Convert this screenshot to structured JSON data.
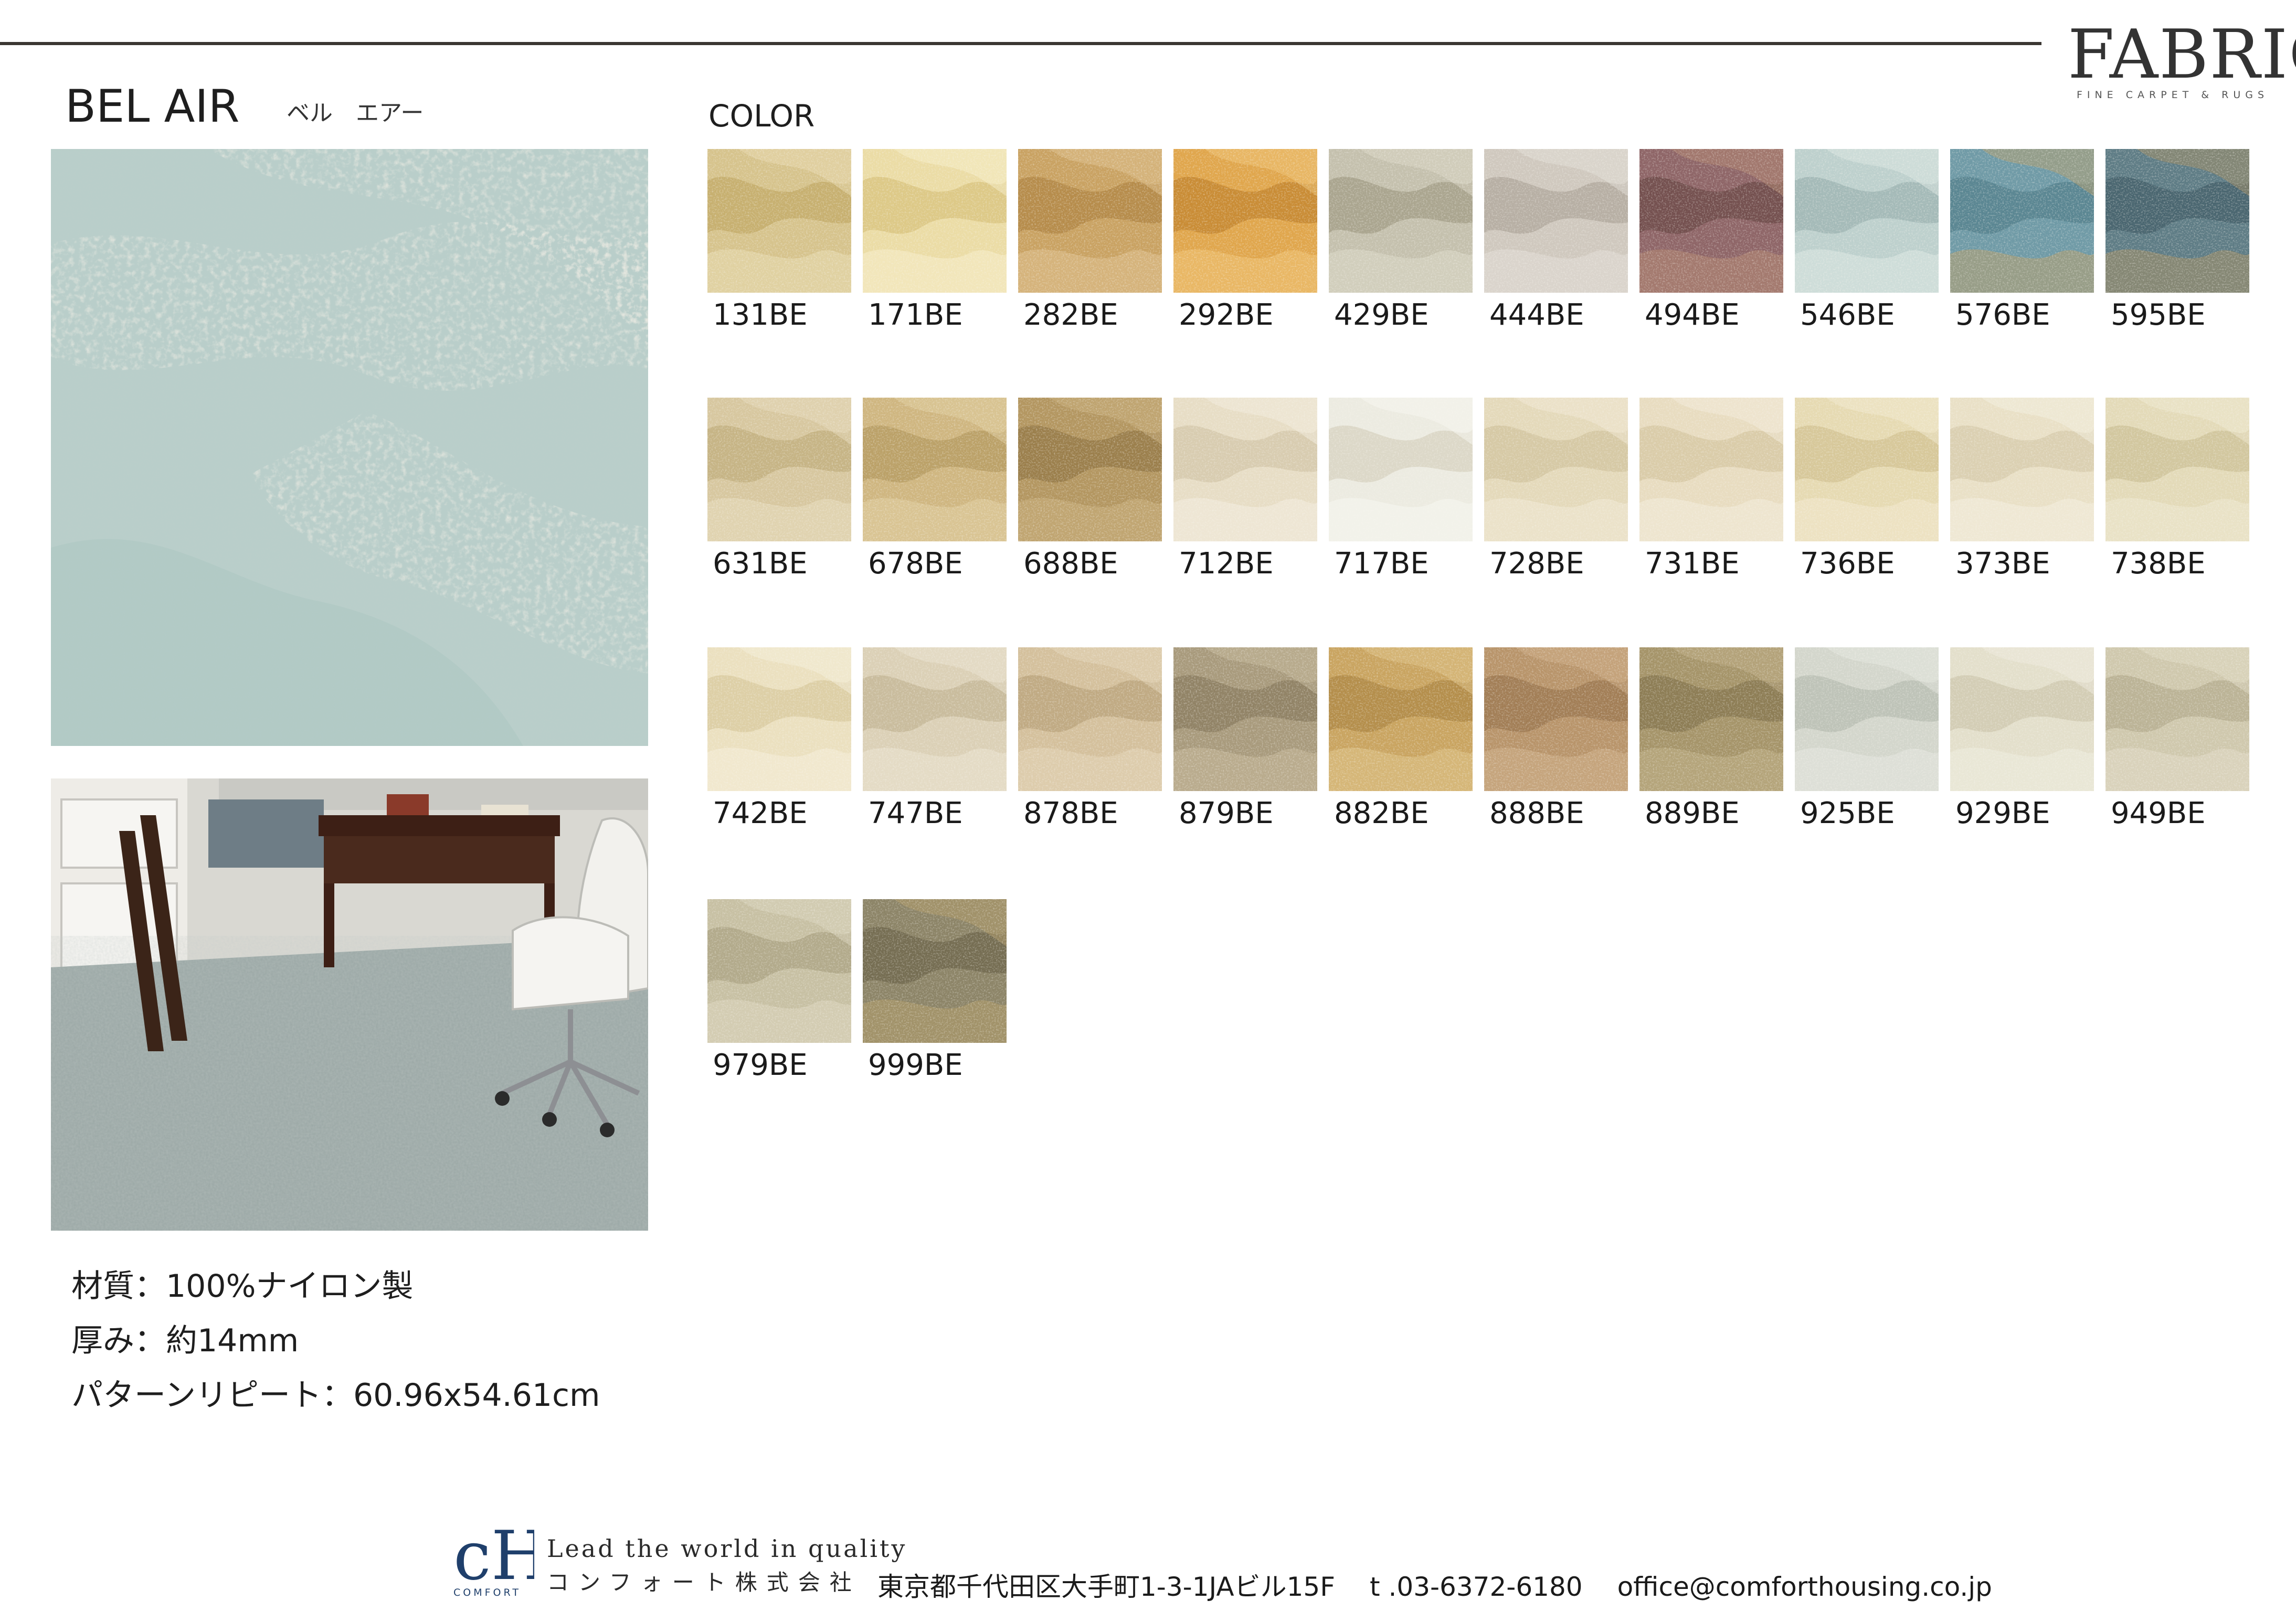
{
  "brand": {
    "logo_word": "FABRICA",
    "logo_sub": "FINE CARPET & RUGS"
  },
  "product": {
    "name": "BEL AIR",
    "name_kana": "ベル　エアー",
    "color_label": "COLOR"
  },
  "specs": [
    "材質：100%ナイロン製",
    "厚み：約14mm",
    "パターンリピート：60.96x54.61cm"
  ],
  "swatches": [
    {
      "code": "131BE",
      "base": "#d6c38c",
      "mid": "#c7b070",
      "light": "#e9dcb2"
    },
    {
      "code": "171BE",
      "base": "#ebdca5",
      "mid": "#ddc987",
      "light": "#f7efcc"
    },
    {
      "code": "282BE",
      "base": "#c9a262",
      "mid": "#b68c4b",
      "light": "#dfc190"
    },
    {
      "code": "292BE",
      "base": "#e0a64c",
      "mid": "#c98c35",
      "light": "#f0c579"
    },
    {
      "code": "429BE",
      "base": "#c4c0ad",
      "mid": "#aaa58f",
      "light": "#dcd8c8"
    },
    {
      "code": "444BE",
      "base": "#cfc8be",
      "mid": "#b7afa4",
      "light": "#e4dfd7"
    },
    {
      "code": "494BE",
      "base": "#8e6567",
      "mid": "#74504f",
      "light": "#b48a74"
    },
    {
      "code": "546BE",
      "base": "#bdd0cd",
      "mid": "#a4bab8",
      "light": "#dde8e4"
    },
    {
      "code": "576BE",
      "base": "#6f9aa6",
      "mid": "#5a8692",
      "light": "#b8a06e"
    },
    {
      "code": "595BE",
      "base": "#5e7c85",
      "mid": "#4a6670",
      "light": "#a68f66"
    },
    {
      "code": "631BE",
      "base": "#d7c79f",
      "mid": "#c6b485",
      "light": "#e8dcbd"
    },
    {
      "code": "678BE",
      "base": "#cfb680",
      "mid": "#bba168",
      "light": "#e2d0a2"
    },
    {
      "code": "688BE",
      "base": "#b39660",
      "mid": "#9b7f4c",
      "light": "#cbb27f"
    },
    {
      "code": "712BE",
      "base": "#e7ddc5",
      "mid": "#d8ccb0",
      "light": "#f4ede0"
    },
    {
      "code": "717BE",
      "base": "#ecebe1",
      "mid": "#dcd8c8",
      "light": "#f8f8f2"
    },
    {
      "code": "728BE",
      "base": "#e4d9ba",
      "mid": "#d6c9a5",
      "light": "#f1ead6"
    },
    {
      "code": "731BE",
      "base": "#e8dcc0",
      "mid": "#dacca9",
      "light": "#f3ecdb"
    },
    {
      "code": "736BE",
      "base": "#e6dab2",
      "mid": "#d7c89a",
      "light": "#f2ead0"
    },
    {
      "code": "373BE",
      "base": "#e9e0c6",
      "mid": "#dbd0b2",
      "light": "#f4efe0"
    },
    {
      "code": "738BE",
      "base": "#e3dab8",
      "mid": "#d2c79f",
      "light": "#efe9d2"
    },
    {
      "code": "742BE",
      "base": "#ebe0bf",
      "mid": "#ddcfa6",
      "light": "#f6efdb"
    },
    {
      "code": "747BE",
      "base": "#dbd0b6",
      "mid": "#c9bc9d",
      "light": "#ebe4d1"
    },
    {
      "code": "878BE",
      "base": "#d4c09c",
      "mid": "#c0aa83",
      "light": "#e4d5b9"
    },
    {
      "code": "879BE",
      "base": "#a89a7c",
      "mid": "#918366",
      "light": "#c6b99b"
    },
    {
      "code": "882BE",
      "base": "#c9a460",
      "mid": "#b48e4b",
      "light": "#dfc48a"
    },
    {
      "code": "888BE",
      "base": "#b8946a",
      "mid": "#a27e56",
      "light": "#cfb08a"
    },
    {
      "code": "889BE",
      "base": "#a59469",
      "mid": "#8d7d55",
      "light": "#c1b089"
    },
    {
      "code": "925BE",
      "base": "#d3d6cc",
      "mid": "#bec3b8",
      "light": "#e6e8e0"
    },
    {
      "code": "929BE",
      "base": "#e3dfcb",
      "mid": "#d3cdb5",
      "light": "#efece0"
    },
    {
      "code": "949BE",
      "base": "#cfc8ad",
      "mid": "#bbb396",
      "light": "#e1dbc6"
    },
    {
      "code": "979BE",
      "base": "#c7c0a3",
      "mid": "#b2aa8b",
      "light": "#dcd6bf"
    },
    {
      "code": "999BE",
      "base": "#8c8467",
      "mid": "#756d52",
      "light": "#b39e6c"
    }
  ],
  "footer": {
    "logo_letters": "cH",
    "logo_caption": "COMFORT",
    "tagline": "Lead the world in quality",
    "company": "コンフォート株式会社",
    "address": "東京都千代田区大手町1-3-1JAビル15F",
    "phone": "t .03-6372-6180",
    "email": "office@comforthousing.co.jp"
  }
}
